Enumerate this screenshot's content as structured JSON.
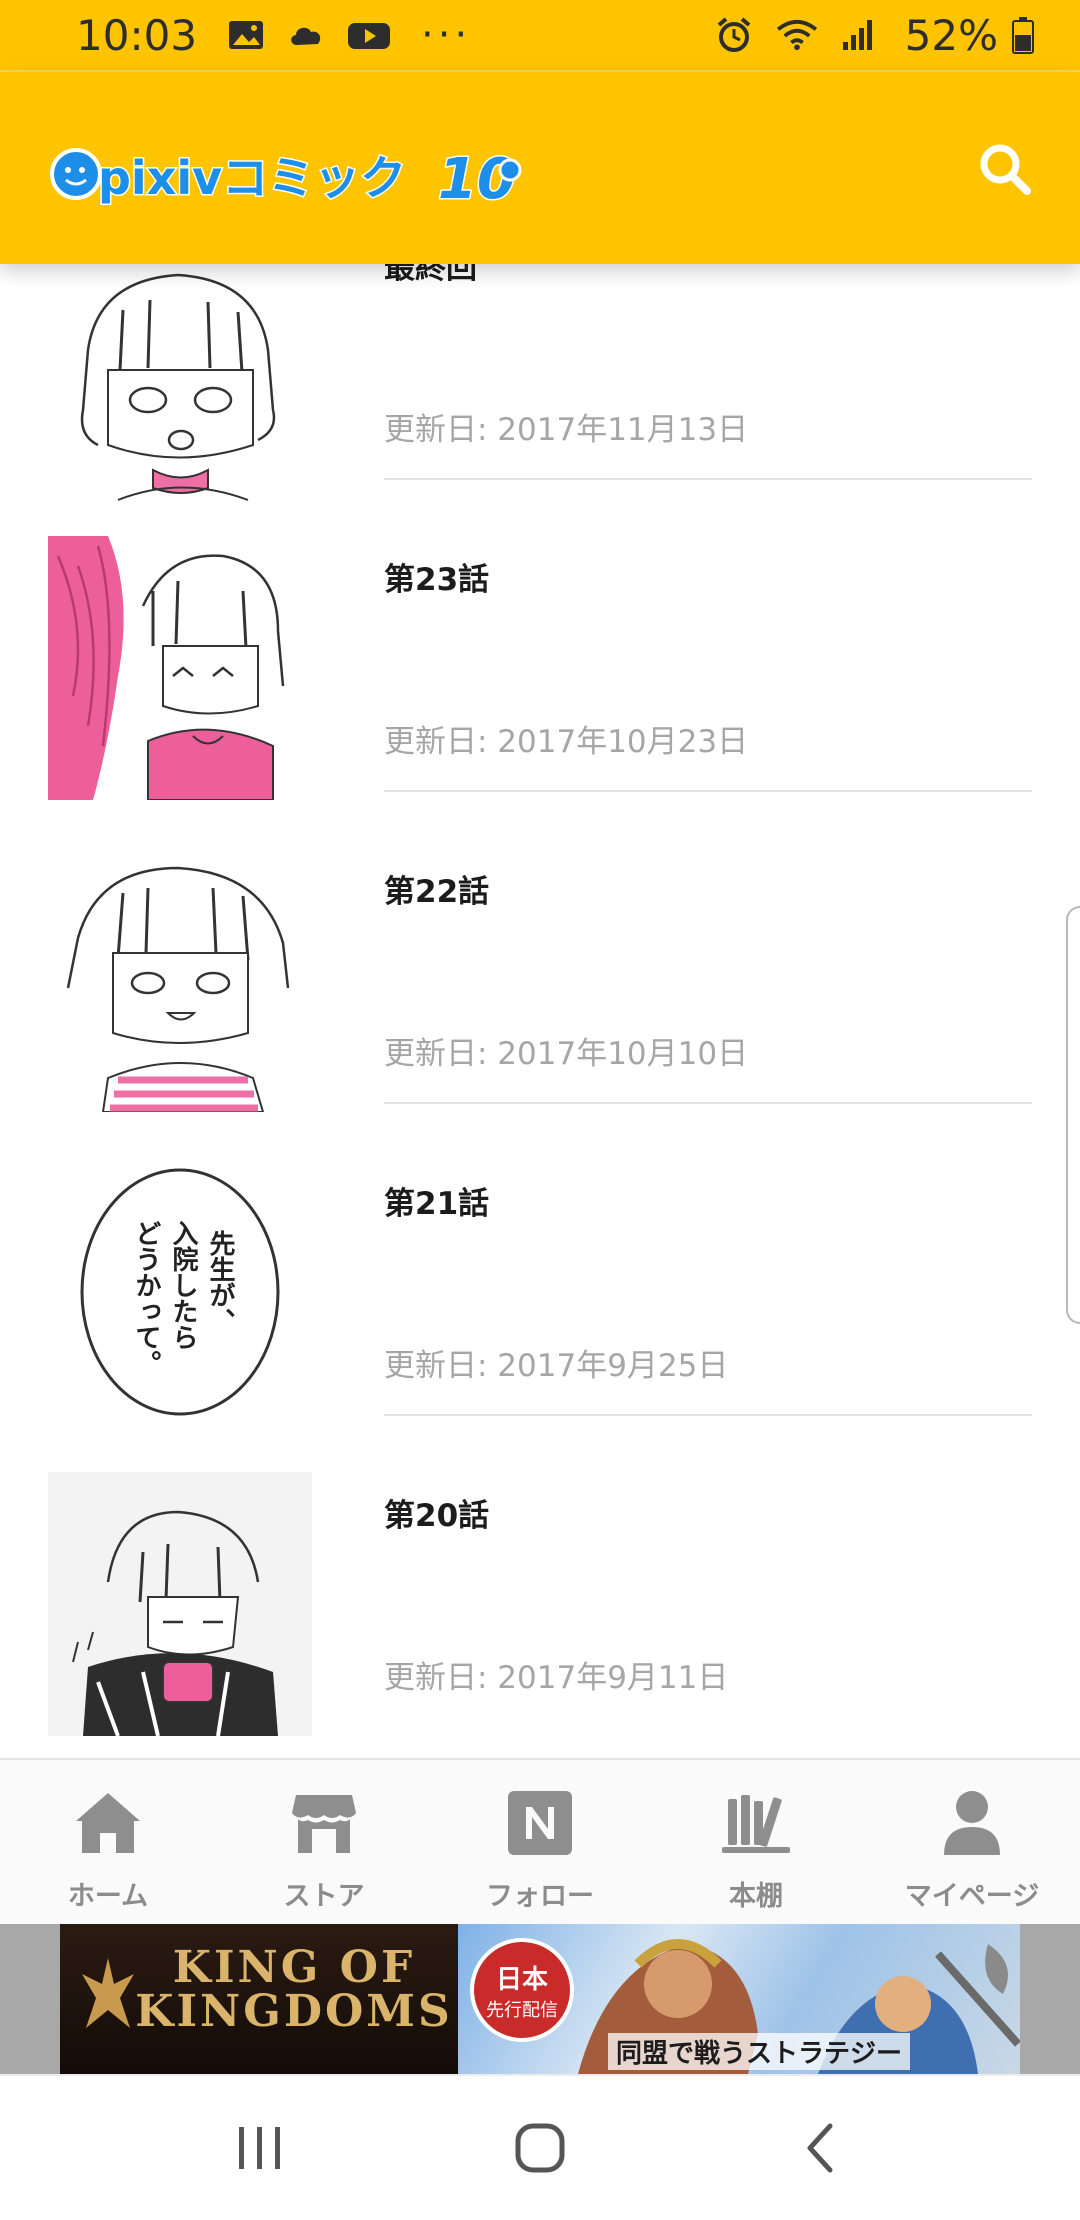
{
  "status_bar": {
    "time": "10:03",
    "battery": "52%",
    "icons": [
      "gallery-icon",
      "cloud-icon",
      "youtube-icon",
      "more-dots-icon",
      "alarm-icon",
      "wifi-icon",
      "signal-icon",
      "battery-icon"
    ],
    "overflow": "···"
  },
  "app_bar": {
    "logo_text": "pixivコミック",
    "logo_badge": "10",
    "search_icon": "search-icon",
    "accent_color": "#ffc400"
  },
  "episodes": [
    {
      "title": "最終回",
      "date": "更新日: 2017年11月13日"
    },
    {
      "title": "第23話",
      "date": "更新日: 2017年10月23日"
    },
    {
      "title": "第22話",
      "date": "更新日: 2017年10月10日"
    },
    {
      "title": "第21話",
      "date": "更新日: 2017年9月25日",
      "thumb_text": "先生が、入院したらどうかって。"
    },
    {
      "title": "第20話",
      "date": "更新日: 2017年9月11日"
    }
  ],
  "bottom_nav": [
    {
      "label": "ホーム",
      "icon": "home-icon"
    },
    {
      "label": "ストア",
      "icon": "store-icon"
    },
    {
      "label": "フォロー",
      "icon": "follow-icon"
    },
    {
      "label": "本棚",
      "icon": "bookshelf-icon"
    },
    {
      "label": "マイページ",
      "icon": "user-icon"
    }
  ],
  "ad": {
    "brand": "KING OF KINGDOMS",
    "badge_line1": "日本",
    "badge_line2": "先行配信",
    "tagline": "同盟で戦うストラテジー"
  },
  "system_nav": [
    "recents-icon",
    "home-circle-icon",
    "back-icon"
  ]
}
